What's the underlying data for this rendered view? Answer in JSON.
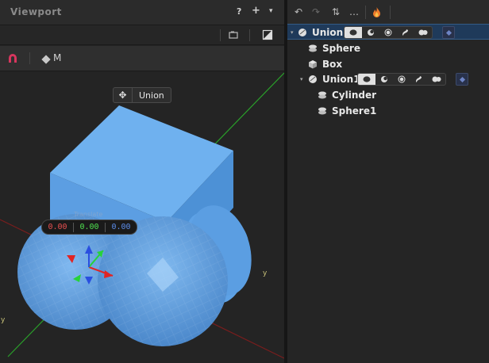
{
  "viewport": {
    "title": "Viewport",
    "help_label": "?",
    "add_label": "+",
    "menu_label": "▾",
    "mode_label": "M",
    "selection_tag": "Union",
    "translate_label": "Translate",
    "coords": {
      "x": "0.00",
      "y": "0.00",
      "z": "0.00"
    }
  },
  "tree": {
    "toolbar": {
      "undo": "↶",
      "redo": "↷",
      "sort": "⇅",
      "more": "…"
    },
    "nodes": [
      {
        "label": "Union",
        "icon": "union-icon",
        "level": 0,
        "expanded": true,
        "selected": true
      },
      {
        "label": "Sphere",
        "icon": "sphere-icon",
        "level": 1
      },
      {
        "label": "Box",
        "icon": "box-icon",
        "level": 1
      },
      {
        "label": "Union1",
        "icon": "union-icon",
        "level": 1,
        "expanded": true
      },
      {
        "label": "Cylinder",
        "icon": "cylinder-icon",
        "level": 2
      },
      {
        "label": "Sphere1",
        "icon": "sphere-icon",
        "level": 2
      }
    ]
  },
  "colors": {
    "accent": "#1f3a5a",
    "shape": "#5b9ee0",
    "axis_x": "#e24040",
    "axis_y": "#3fd24f",
    "axis_z": "#4f7fe8"
  }
}
